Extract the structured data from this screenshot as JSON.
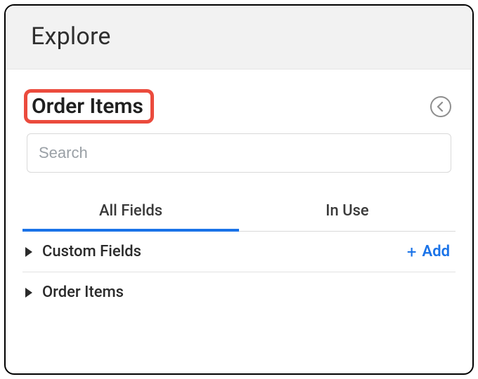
{
  "header": {
    "title": "Explore"
  },
  "panel": {
    "title": "Order Items",
    "highlight_color": "#eb4b3d",
    "collapse_icon": "chevron-left"
  },
  "search": {
    "placeholder": "Search",
    "value": ""
  },
  "tabs": {
    "items": [
      {
        "label": "All Fields",
        "active": true
      },
      {
        "label": "In Use",
        "active": false
      }
    ]
  },
  "sections": [
    {
      "label": "Custom Fields",
      "expanded": false,
      "add_label": "Add"
    },
    {
      "label": "Order Items",
      "expanded": false
    }
  ],
  "colors": {
    "accent": "#1a73e8"
  }
}
